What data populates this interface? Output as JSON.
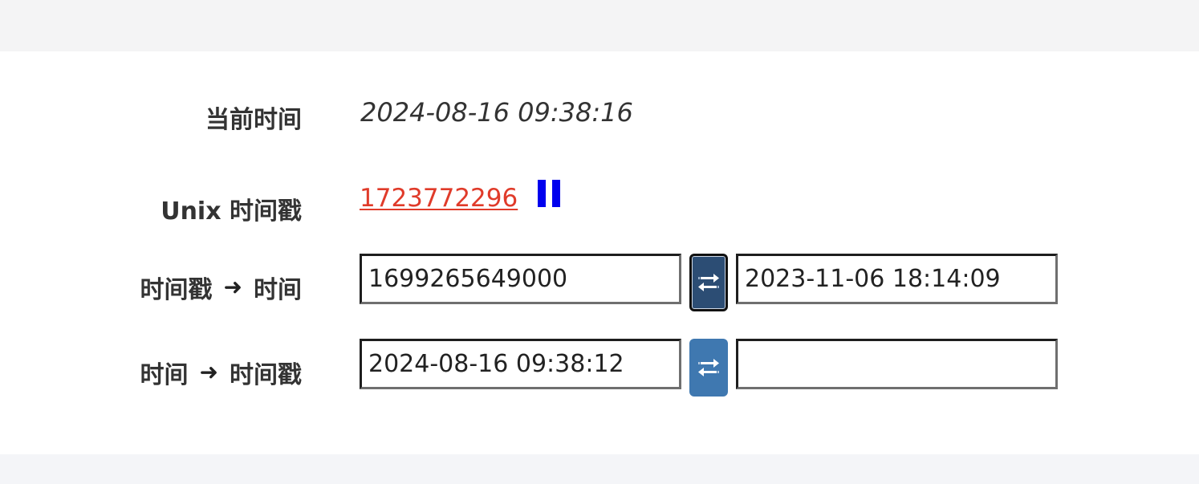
{
  "labels": {
    "current_time": "当前时间",
    "unix_timestamp": "Unix 时间戳",
    "ts_to_time_left": "时间戳",
    "ts_to_time_right": "时间",
    "time_to_ts_left": "时间",
    "time_to_ts_right": "时间戳",
    "arrow": "➜"
  },
  "current_time": {
    "value": "2024-08-16 09:38:16"
  },
  "unix": {
    "timestamp": "1723772296",
    "pause_icon": "pause-icon"
  },
  "ts_to_time": {
    "input_value": "1699265649000",
    "output_value": "2023-11-06 18:14:09",
    "button_icon": "swap-arrows-icon"
  },
  "time_to_ts": {
    "input_value": "2024-08-16 09:38:12",
    "output_value": "",
    "button_icon": "swap-arrows-icon"
  },
  "colors": {
    "link_red": "#e03b2a",
    "pause_blue": "#0000ee",
    "button_blue": "#3f78b0",
    "button_active": "#2c4d74"
  }
}
